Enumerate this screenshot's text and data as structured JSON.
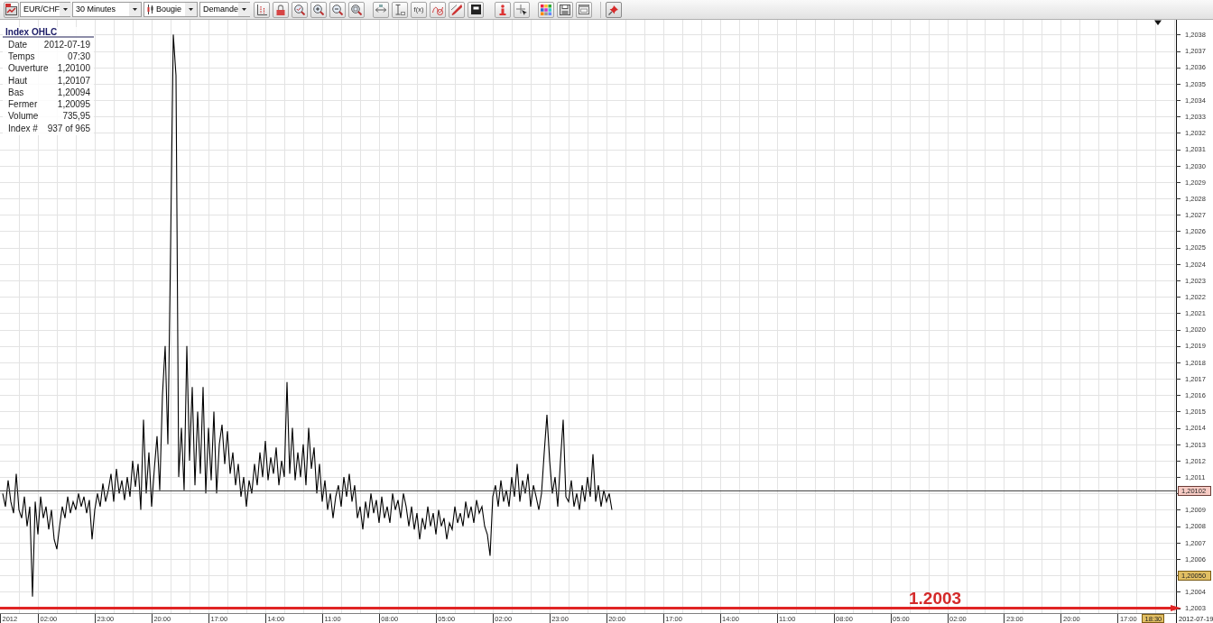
{
  "toolbar": {
    "dropdowns": [
      {
        "kind": "symbol",
        "value": "EUR/CHF"
      },
      {
        "kind": "interval",
        "value": "30 Minutes"
      },
      {
        "kind": "chart_type",
        "value": "Bougie"
      },
      {
        "kind": "price_side",
        "value": "Demande"
      }
    ],
    "formula_button": {
      "label": "f(x)"
    }
  },
  "ohlc_panel": {
    "title": "Index OHLC",
    "rows": [
      {
        "label": "Date",
        "value": "2012-07-19"
      },
      {
        "label": "Temps",
        "value": "07:30"
      },
      {
        "label": "Ouverture",
        "value": "1,20100"
      },
      {
        "label": "Haut",
        "value": "1,20107"
      },
      {
        "label": "Bas",
        "value": "1,20094"
      },
      {
        "label": "Fermer",
        "value": "1,20095"
      },
      {
        "label": "Volume",
        "value": "735,95"
      },
      {
        "label": "Index #",
        "value": "937 of 965"
      }
    ]
  },
  "chart": {
    "price_axis": {
      "labels": [
        "1,2038",
        "1,2037",
        "1,2036",
        "1,2035",
        "1,2034",
        "1,2033",
        "1,2032",
        "1,2031",
        "1,2030",
        "1,2029",
        "1,2028",
        "1,2027",
        "1,2026",
        "1,2025",
        "1,2024",
        "1,2023",
        "1,2022",
        "1,2021",
        "1,2020",
        "1,2019",
        "1,2018",
        "1,2017",
        "1,2016",
        "1,2015",
        "1,2014",
        "1,2013",
        "1,2012",
        "1,2011",
        "1,2009",
        "1,2008",
        "1,2007",
        "1,2006",
        "1,2004",
        "1,2003"
      ]
    },
    "time_axis": {
      "labels": [
        "2012",
        "02:00",
        "23:00",
        "20:00",
        "17:00",
        "14:00",
        "11:00",
        "08:00",
        "05:00",
        "02:00",
        "23:00",
        "20:00",
        "17:00",
        "14:00",
        "11:00",
        "08:00",
        "05:00",
        "02:00",
        "23:00",
        "20:00",
        "17:00"
      ]
    },
    "price_tags": [
      {
        "kind": "last_price",
        "text": "1,20102"
      },
      {
        "kind": "marker",
        "text": "1,20050"
      }
    ],
    "alert_line": {
      "label": "1.2003"
    },
    "cursor_time": {
      "text": "18:30"
    },
    "cursor_date": {
      "text": "2012-07-19"
    }
  }
}
